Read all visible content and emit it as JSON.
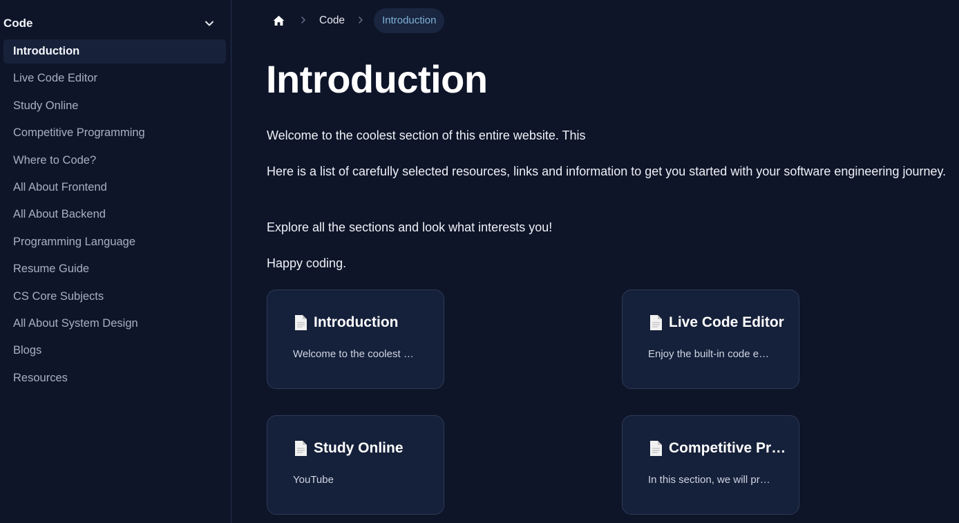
{
  "sidebar": {
    "header": "Code",
    "items": [
      {
        "label": "Introduction",
        "active": true
      },
      {
        "label": "Live Code Editor"
      },
      {
        "label": "Study Online"
      },
      {
        "label": "Competitive Programming"
      },
      {
        "label": "Where to Code?"
      },
      {
        "label": "All About Frontend"
      },
      {
        "label": "All About Backend"
      },
      {
        "label": "Programming Language"
      },
      {
        "label": "Resume Guide"
      },
      {
        "label": "CS Core Subjects"
      },
      {
        "label": "All About System Design"
      },
      {
        "label": "Blogs"
      },
      {
        "label": "Resources"
      }
    ]
  },
  "breadcrumb": {
    "parent": "Code",
    "current": "Introduction"
  },
  "main": {
    "title": "Introduction",
    "paragraphs": [
      "Welcome to the coolest section of this entire website. This",
      "Here is a list of carefully selected resources, links and information to get you started with your software engineering journey.",
      "Explore all the sections and look what interests you!",
      "Happy coding."
    ]
  },
  "cards": [
    {
      "title": "Introduction",
      "description": "Welcome to the coolest section of this entire website"
    },
    {
      "title": "Live Code Editor",
      "description": "Enjoy the built-in code editor"
    },
    {
      "title": "Study Online",
      "description": "YouTube"
    },
    {
      "title": "Competitive Programming",
      "description": "In this section, we will provide"
    }
  ],
  "colors": {
    "background": "#0e1529",
    "card": "#15203a",
    "accent": "#7fb1d6"
  },
  "icons": [
    "chevron-down-icon",
    "home-icon",
    "chevron-right-icon",
    "document-icon"
  ]
}
